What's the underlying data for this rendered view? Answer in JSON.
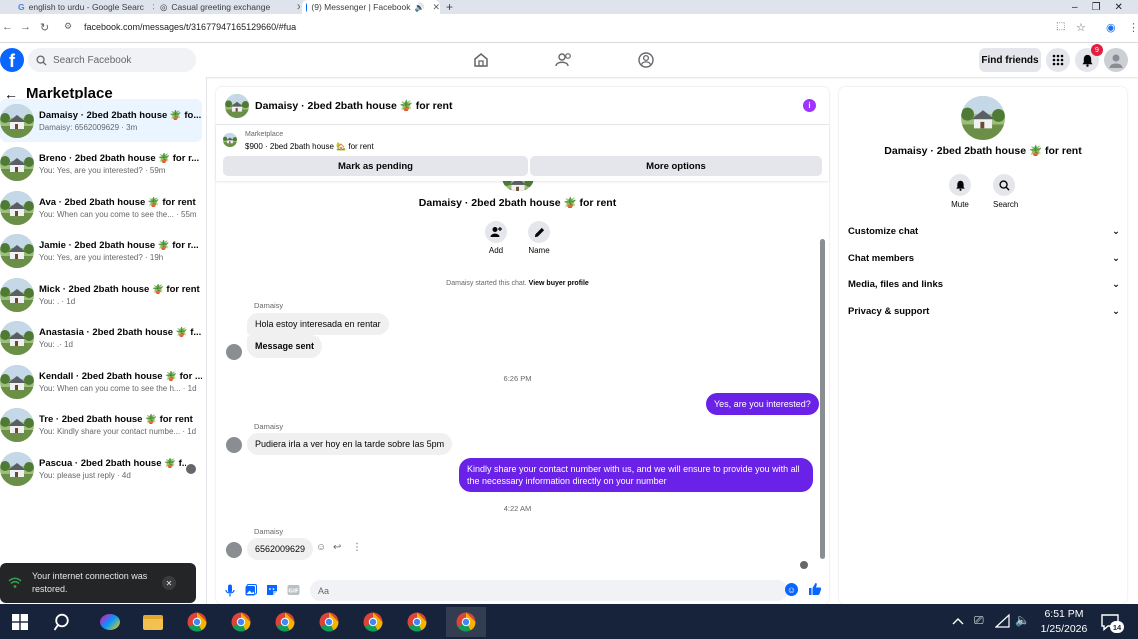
{
  "browser": {
    "tabs": [
      {
        "title": "english to urdu - Google Searc",
        "active": false
      },
      {
        "title": "Casual greeting exchange",
        "active": false
      },
      {
        "title": "(9) Messenger | Facebook",
        "active": true
      }
    ],
    "url": "facebook.com/messages/t/31677947165129660/#fua"
  },
  "header": {
    "search_placeholder": "Search Facebook",
    "find_friends": "Find friends",
    "notification_count": "9"
  },
  "sidebar": {
    "title": "Marketplace",
    "conversations": [
      {
        "title": "Damaisy · 2bed 2bath house 🪴 fo...",
        "subtitle": "Damaisy: 6562009629 · 3m",
        "selected": true
      },
      {
        "title": "Breno · 2bed 2bath house 🪴 for r...",
        "subtitle": "You: Yes, are you interested? · 59m",
        "selected": false
      },
      {
        "title": "Ava · 2bed 2bath house 🪴 for rent",
        "subtitle": "You: When can you come to see the... · 55m",
        "selected": false
      },
      {
        "title": "Jamie · 2bed 2bath house 🪴 for r...",
        "subtitle": "You: Yes, are you interested? · 19h",
        "selected": false
      },
      {
        "title": "Mick · 2bed 2bath house 🪴 for rent",
        "subtitle": "You: . · 1d",
        "selected": false
      },
      {
        "title": "Anastasia · 2bed 2bath house 🪴 f...",
        "subtitle": "You: .· 1d",
        "selected": false
      },
      {
        "title": "Kendall · 2bed 2bath house 🪴 for ...",
        "subtitle": "You: When can you come to see the h... · 1d",
        "selected": false
      },
      {
        "title": "Tre · 2bed 2bath house 🪴 for rent",
        "subtitle": "You: Kindly share your contact numbe... · 1d",
        "selected": false
      },
      {
        "title": "Pascua · 2bed 2bath house 🪴 f...",
        "subtitle": "You: please just reply · 4d",
        "selected": false
      }
    ],
    "toast": "Your internet connection was restored."
  },
  "chat": {
    "title": "Damaisy · 2bed 2bath house 🪴 for rent",
    "marketplace_label": "Marketplace",
    "listing": "$900 · 2bed 2bath house 🏡 for rent",
    "mark_pending": "Mark as pending",
    "more_options": "More options",
    "intro_title": "Damaisy · 2bed 2bath house 🪴 for rent",
    "add_label": "Add",
    "name_label": "Name",
    "started_text": "Damaisy started this chat.",
    "view_profile": "View buyer profile",
    "sender_name": "Damaisy",
    "msg1": "Hola estoy interesada en rentar",
    "msg2": "Message sent",
    "time1": "6:26 PM",
    "msg3": "Yes, are you interested?",
    "msg4": "Pudiera irla a ver hoy en la tarde sobre las 5pm",
    "msg5": "Kindly share your contact number with us, and we will ensure to provide you with all the necessary information directly on your number",
    "time2": "4:22 AM",
    "msg6": "6562009629",
    "composer_placeholder": "Aa"
  },
  "info": {
    "title": "Damaisy · 2bed 2bath house 🪴 for rent",
    "mute": "Mute",
    "search": "Search",
    "sections": [
      "Customize chat",
      "Chat members",
      "Media, files and links",
      "Privacy & support"
    ]
  },
  "taskbar": {
    "time": "6:51 PM",
    "date": "1/25/2026",
    "notif_count": "14"
  },
  "colors": {
    "accent": "#6a21e8",
    "fb_blue": "#0866ff"
  }
}
